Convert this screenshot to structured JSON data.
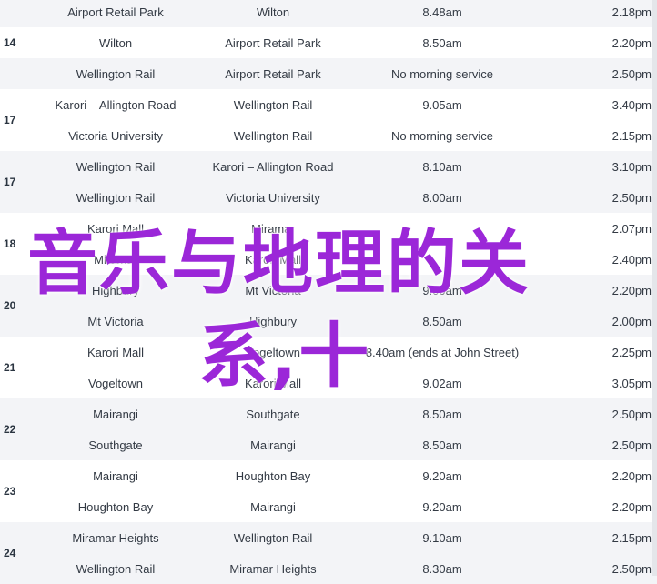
{
  "groups": [
    {
      "route": "",
      "rows": [
        {
          "from": "Airport Retail Park",
          "to": "Wilton",
          "first": "8.48am",
          "last": "2.18pm"
        }
      ]
    },
    {
      "route": "14",
      "rows": [
        {
          "from": "Wilton",
          "to": "Airport Retail Park",
          "first": "8.50am",
          "last": "2.20pm"
        }
      ]
    },
    {
      "route": "",
      "rows": [
        {
          "from": "Wellington Rail",
          "to": "Airport Retail Park",
          "first": "No morning service",
          "last": "2.50pm"
        }
      ]
    },
    {
      "route": "17",
      "rows": [
        {
          "from": "Karori – Allington Road",
          "to": "Wellington Rail",
          "first": "9.05am",
          "last": "3.40pm"
        },
        {
          "from": "Victoria University",
          "to": "Wellington Rail",
          "first": "No morning service",
          "last": "2.15pm"
        }
      ]
    },
    {
      "route": "17",
      "rows": [
        {
          "from": "Wellington Rail",
          "to": "Karori – Allington Road",
          "first": "8.10am",
          "last": "3.10pm"
        },
        {
          "from": "Wellington Rail",
          "to": "Victoria University",
          "first": "8.00am",
          "last": "2.50pm"
        }
      ]
    },
    {
      "route": "18",
      "rows": [
        {
          "from": "Karori Mall",
          "to": "Miramar",
          "first": "",
          "last": "2.07pm"
        },
        {
          "from": "Miramar",
          "to": "Karori Mall",
          "first": "",
          "last": "2.40pm"
        }
      ]
    },
    {
      "route": "20",
      "rows": [
        {
          "from": "Highbury",
          "to": "Mt Victoria",
          "first": "9.00am",
          "last": "2.20pm"
        },
        {
          "from": "Mt Victoria",
          "to": "Highbury",
          "first": "8.50am",
          "last": "2.00pm"
        }
      ]
    },
    {
      "route": "21",
      "rows": [
        {
          "from": "Karori Mall",
          "to": "Vogeltown",
          "first": "8.40am (ends at John Street)",
          "last": "2.25pm"
        },
        {
          "from": "Vogeltown",
          "to": "Karori Mall",
          "first": "9.02am",
          "last": "3.05pm"
        }
      ]
    },
    {
      "route": "22",
      "rows": [
        {
          "from": "Mairangi",
          "to": "Southgate",
          "first": "8.50am",
          "last": "2.50pm"
        },
        {
          "from": "Southgate",
          "to": "Mairangi",
          "first": "8.50am",
          "last": "2.50pm"
        }
      ]
    },
    {
      "route": "23",
      "rows": [
        {
          "from": "Mairangi",
          "to": "Houghton Bay",
          "first": "9.20am",
          "last": "2.20pm"
        },
        {
          "from": "Houghton Bay",
          "to": "Mairangi",
          "first": "9.20am",
          "last": "2.20pm"
        }
      ]
    },
    {
      "route": "24",
      "rows": [
        {
          "from": "Miramar Heights",
          "to": "Wellington Rail",
          "first": "9.10am",
          "last": "2.15pm"
        },
        {
          "from": "Wellington Rail",
          "to": "Miramar Heights",
          "first": "8.30am",
          "last": "2.50pm"
        }
      ]
    }
  ],
  "overlay": {
    "line1": "音乐与地理的关",
    "line2": "系,十",
    "color": "#9b27d8"
  }
}
